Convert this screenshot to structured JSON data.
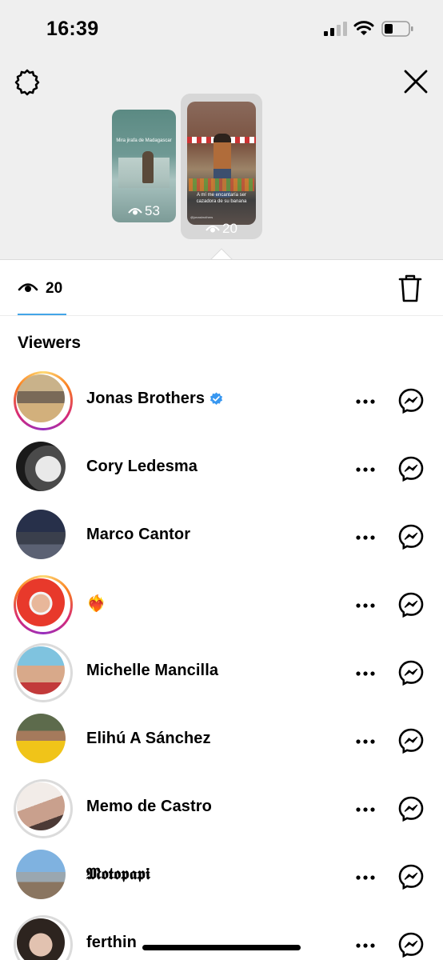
{
  "status_bar": {
    "time": "16:39"
  },
  "stories": [
    {
      "caption": "Mira jirafa de Madagascar",
      "views": "53"
    },
    {
      "caption": "A mí me encantaría ser cazadora de su banana",
      "handle": "@jonasbrothers",
      "views": "20"
    }
  ],
  "tab": {
    "view_count": "20"
  },
  "section_title": "Viewers",
  "viewers": [
    {
      "name": "Jonas Brothers",
      "verified": true,
      "ring": "story"
    },
    {
      "name": "Cory Ledesma",
      "ring": "none"
    },
    {
      "name": "Marco Cantor",
      "ring": "none"
    },
    {
      "name": "❤️‍🔥",
      "ring": "story"
    },
    {
      "name": "Michelle Mancilla",
      "ring": "seen"
    },
    {
      "name": "Elihú A Sánchez",
      "ring": "none"
    },
    {
      "name": "Memo de Castro",
      "ring": "seen"
    },
    {
      "name": "𝕸𝖔𝖙𝖔𝖕𝖆𝖕𝖎",
      "ring": "none"
    },
    {
      "name": "ferthin",
      "ring": "seen"
    }
  ],
  "colors": {
    "tab_underline": "#43a5e8",
    "verified": "#3897f0"
  }
}
